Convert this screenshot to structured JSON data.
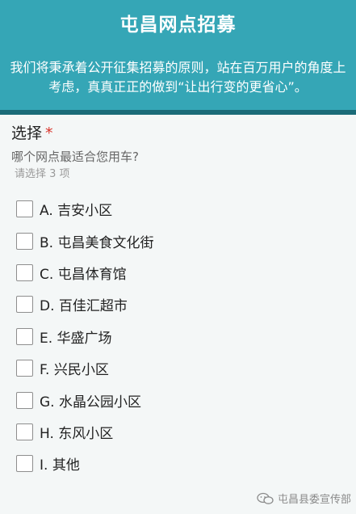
{
  "header": {
    "title": "屯昌网点招募",
    "description": "我们将秉承着公开征集招募的原则，站在百万用户的角度上考虑，真真正正的做到“让出行变的更省心”。"
  },
  "question": {
    "title": "选择",
    "required_mark": "*",
    "description": "哪个网点最适合您用车?",
    "hint": "请选择 3 项",
    "options": [
      "A. 吉安小区",
      "B. 屯昌美食文化街",
      "C. 屯昌体育馆",
      "D. 百佳汇超市",
      "E. 华盛广场",
      "F. 兴民小区",
      "G. 水晶公园小区",
      "H. 东风小区",
      "I. 其他"
    ]
  },
  "watermark": {
    "text": "屯昌县委宣传部",
    "icon": "wechat-icon"
  },
  "colors": {
    "header_bg": "#35a6b6",
    "header_border": "#1b6b78",
    "required": "#d9342b"
  }
}
